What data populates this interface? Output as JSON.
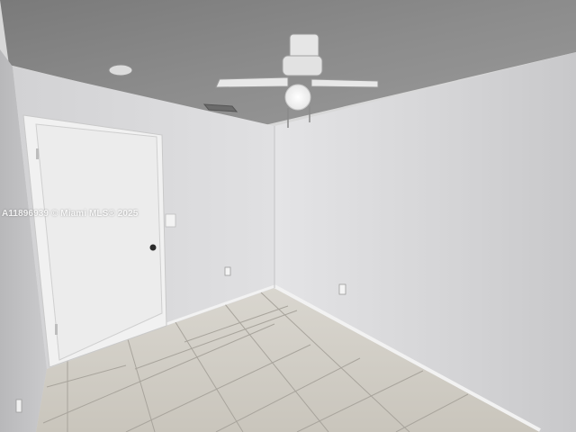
{
  "photo": {
    "subject": "",
    "watermark": "A11896939 © Miami MLS® 2025"
  }
}
